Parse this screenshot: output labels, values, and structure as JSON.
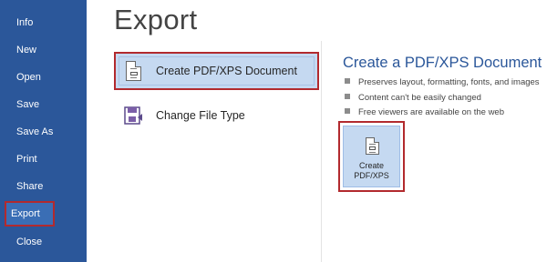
{
  "sidebar": {
    "items": [
      {
        "label": "Info"
      },
      {
        "label": "New"
      },
      {
        "label": "Open"
      },
      {
        "label": "Save"
      },
      {
        "label": "Save As"
      },
      {
        "label": "Print"
      },
      {
        "label": "Share"
      },
      {
        "label": "Export",
        "active": true
      },
      {
        "label": "Close"
      }
    ]
  },
  "main": {
    "title": "Export",
    "options": [
      {
        "label": "Create PDF/XPS Document",
        "icon": "pdf-document-icon",
        "selected": true
      },
      {
        "label": "Change File Type",
        "icon": "change-file-type-icon",
        "selected": false
      }
    ]
  },
  "detail": {
    "title": "Create a PDF/XPS Document",
    "bullets": [
      "Preserves layout, formatting, fonts, and images",
      "Content can't be easily changed",
      "Free viewers are available on the web"
    ],
    "button": {
      "line1": "Create",
      "line2": "PDF/XPS"
    }
  },
  "colors": {
    "sidebar": "#2b579a",
    "highlight_border": "#b22a2e",
    "selection": "#c5d9f1",
    "accent_text": "#2b579a"
  }
}
